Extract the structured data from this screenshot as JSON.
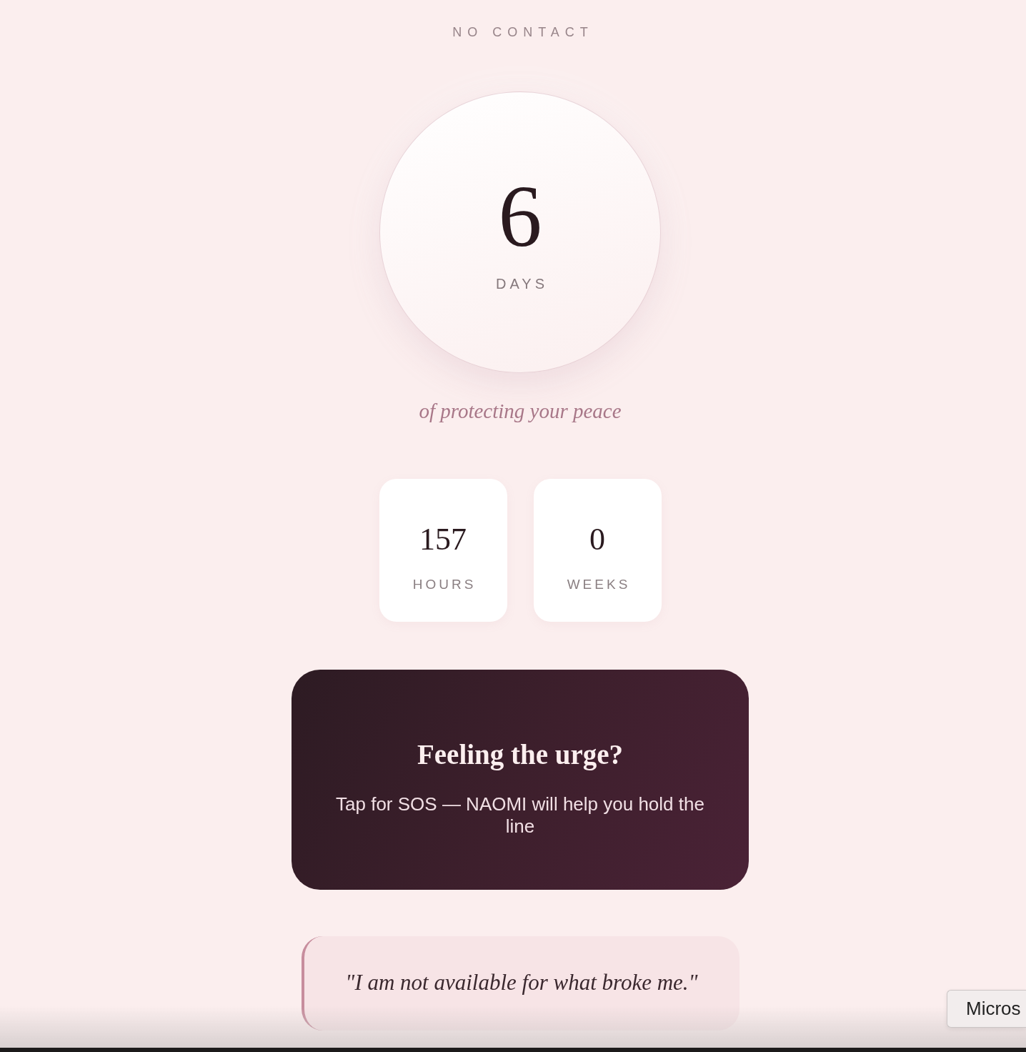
{
  "header": {
    "title": "NO CONTACT"
  },
  "counter": {
    "value": "6",
    "unit": "DAYS"
  },
  "tagline": "of protecting your peace",
  "stats": [
    {
      "value": "157",
      "unit": "HOURS"
    },
    {
      "value": "0",
      "unit": "WEEKS"
    }
  ],
  "sos_card": {
    "title": "Feeling the urge?",
    "subtitle": "Tap for SOS — NAOMI will help you hold the line"
  },
  "quote": {
    "text": "\"I am not available for what broke me.\""
  },
  "popup_button": {
    "label": "Micros"
  }
}
